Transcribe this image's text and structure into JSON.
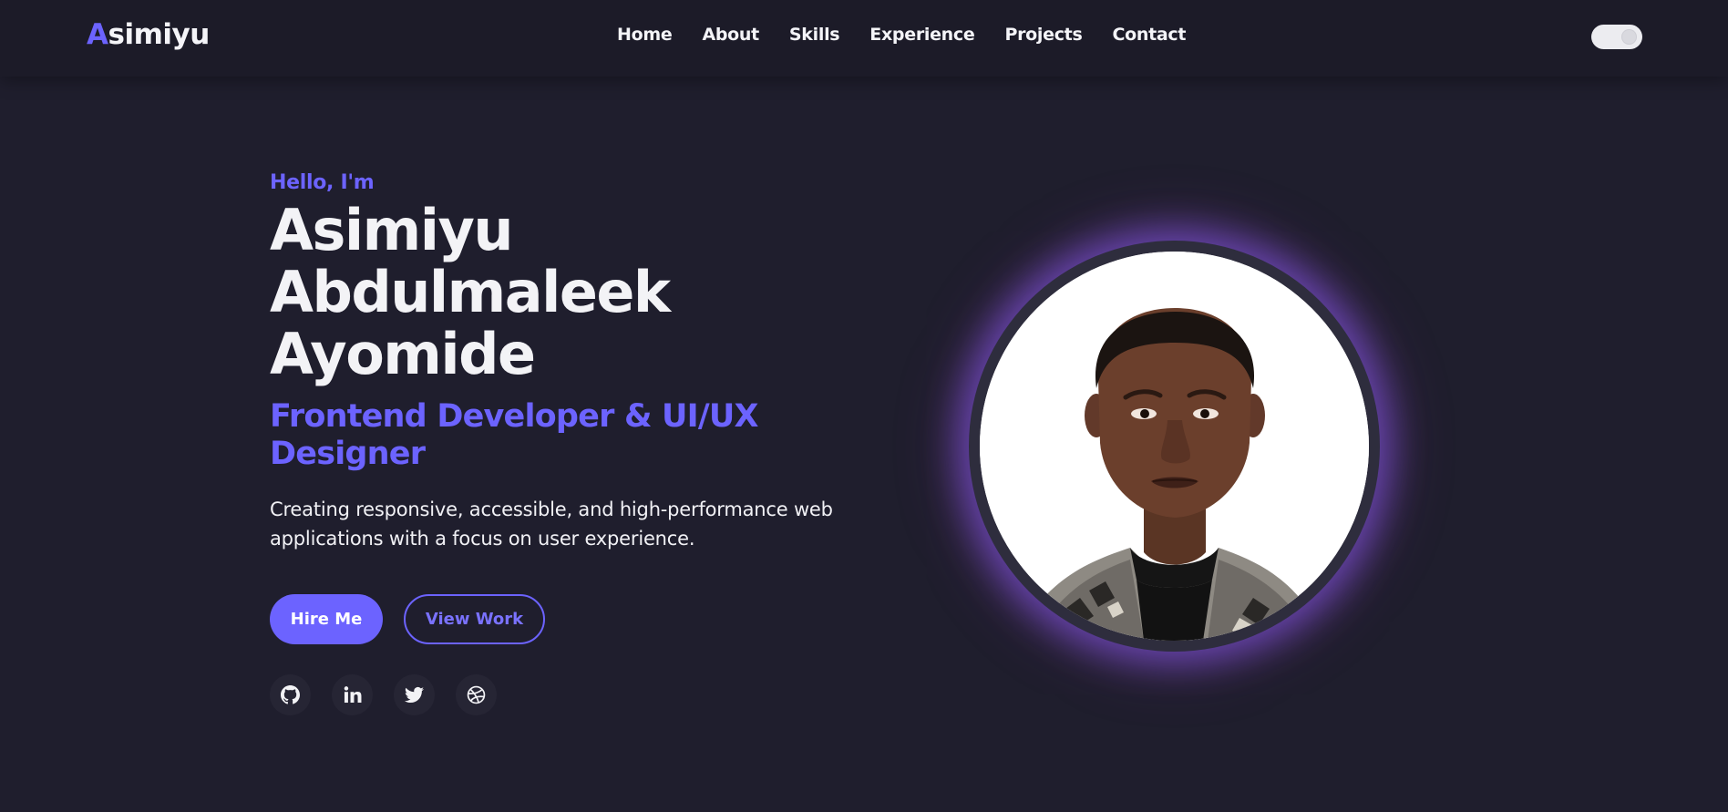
{
  "nav": {
    "logo_accent": "A",
    "logo_rest": "simiyu",
    "links": [
      "Home",
      "About",
      "Skills",
      "Experience",
      "Projects",
      "Contact"
    ]
  },
  "hero": {
    "greeting": "Hello, I'm",
    "name_lines": [
      "Asimiyu",
      "Abdulmaleek",
      "Ayomide"
    ],
    "role": "Frontend Developer & UI/UX Designer",
    "description": "Creating responsive, accessible, and high-performance web applications with a focus on user experience.",
    "primary_button": "Hire Me",
    "secondary_button": "View Work"
  },
  "socials": [
    {
      "icon": "github-icon"
    },
    {
      "icon": "linkedin-icon"
    },
    {
      "icon": "twitter-icon"
    },
    {
      "icon": "dribbble-icon"
    }
  ],
  "colors": {
    "accent": "#6c63ff",
    "background": "#1f1e2d",
    "navbar": "#1c1b28"
  }
}
